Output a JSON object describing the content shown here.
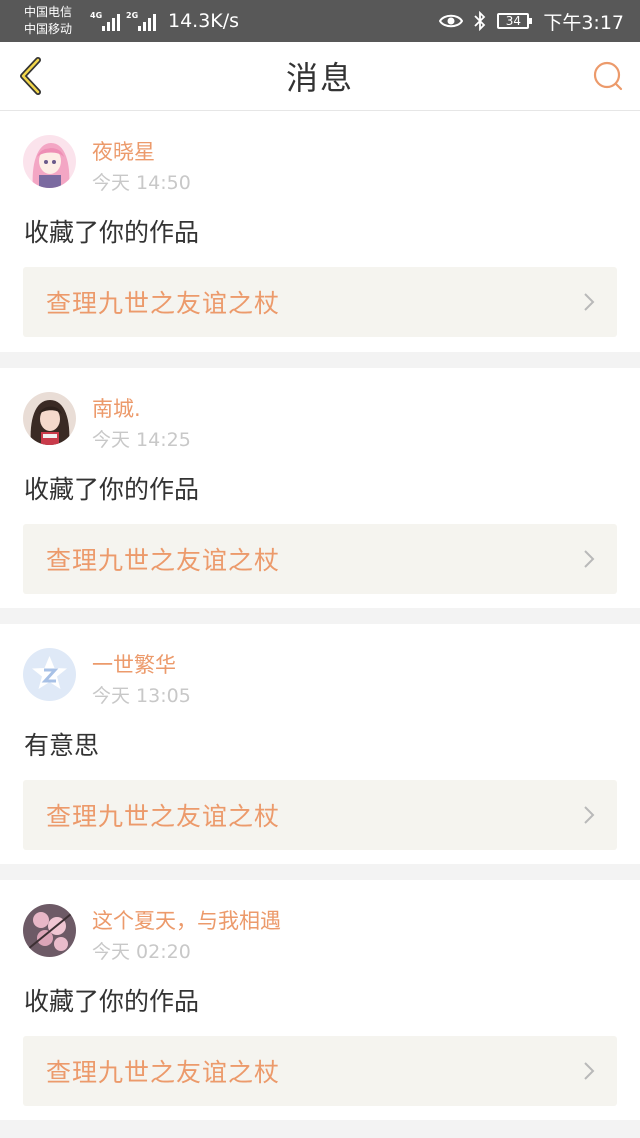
{
  "status_bar": {
    "carrier_1": "中国电信",
    "carrier_2": "中国移动",
    "net_1": "4G",
    "net_2": "2G",
    "speed": "14.3K/s",
    "battery": "34",
    "time": "下午3:17"
  },
  "nav": {
    "title": "消息",
    "back_icon": "chevron-left-icon",
    "search_icon": "search-icon",
    "accent_color": "#ec9a6b"
  },
  "messages": [
    {
      "username": "夜晓星",
      "time": "今天 14:50",
      "text": "收藏了你的作品",
      "work_title": "查理九世之友谊之杖",
      "avatar": "anime-girl-avatar"
    },
    {
      "username": "南城.",
      "time": "今天 14:25",
      "text": "收藏了你的作品",
      "work_title": "查理九世之友谊之杖",
      "avatar": "girl-photo-avatar"
    },
    {
      "username": "一世繁华",
      "time": "今天 13:05",
      "text": "有意思",
      "work_title": "查理九世之友谊之杖",
      "avatar": "default-star-avatar"
    },
    {
      "username": "这个夏天，与我相遇",
      "time": "今天 02:20",
      "text": "收藏了你的作品",
      "work_title": "查理九世之友谊之杖",
      "avatar": "blossom-avatar"
    }
  ]
}
